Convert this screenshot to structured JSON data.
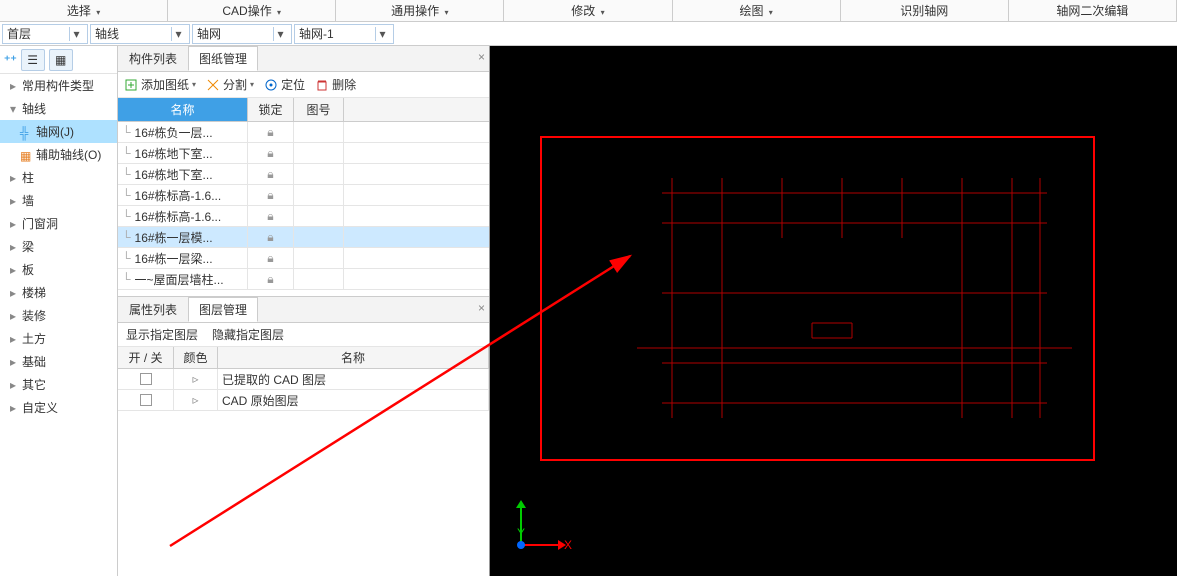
{
  "ribbon": [
    "选择",
    "CAD操作",
    "通用操作",
    "修改",
    "绘图",
    "识别轴网",
    "轴网二次编辑"
  ],
  "ribbon_caret": [
    true,
    true,
    true,
    true,
    true,
    false,
    false
  ],
  "selectors": [
    {
      "label": "首层",
      "w": 86
    },
    {
      "label": "轴线",
      "w": 100
    },
    {
      "label": "轴网",
      "w": 100
    },
    {
      "label": "轴网-1",
      "w": 100
    }
  ],
  "tree": [
    {
      "label": "常用构件类型",
      "glyph": "▸"
    },
    {
      "label": "轴线",
      "glyph": "▾"
    },
    {
      "label": "轴网(J)",
      "sub": true,
      "selected": true,
      "icon": "grid"
    },
    {
      "label": "辅助轴线(O)",
      "sub": true,
      "icon": "aux"
    },
    {
      "label": "柱",
      "glyph": "▸"
    },
    {
      "label": "墙",
      "glyph": "▸"
    },
    {
      "label": "门窗洞",
      "glyph": "▸"
    },
    {
      "label": "梁",
      "glyph": "▸"
    },
    {
      "label": "板",
      "glyph": "▸"
    },
    {
      "label": "楼梯",
      "glyph": "▸"
    },
    {
      "label": "装修",
      "glyph": "▸"
    },
    {
      "label": "土方",
      "glyph": "▸"
    },
    {
      "label": "基础",
      "glyph": "▸"
    },
    {
      "label": "其它",
      "glyph": "▸"
    },
    {
      "label": "自定义",
      "glyph": "▸"
    }
  ],
  "panel1": {
    "tabs": [
      "构件列表",
      "图纸管理"
    ],
    "active": 1,
    "toolbar": [
      "添加图纸",
      "分割",
      "定位",
      "删除"
    ],
    "headers": [
      "名称",
      "锁定",
      "图号"
    ],
    "rows": [
      {
        "name": "16#栋负一层..."
      },
      {
        "name": "16#栋地下室..."
      },
      {
        "name": "16#栋地下室..."
      },
      {
        "name": "16#栋标高-1.6..."
      },
      {
        "name": "16#栋标高-1.6..."
      },
      {
        "name": "16#栋一层模...",
        "selected": true
      },
      {
        "name": "16#栋一层梁..."
      },
      {
        "name": "一~屋面层墙柱..."
      }
    ]
  },
  "panel2": {
    "tabs": [
      "属性列表",
      "图层管理"
    ],
    "active": 1,
    "sub": [
      "显示指定图层",
      "隐藏指定图层"
    ],
    "headers": [
      "开 / 关",
      "颜色",
      "名称"
    ],
    "rows": [
      {
        "name": "已提取的 CAD 图层"
      },
      {
        "name": "CAD 原始图层"
      }
    ]
  },
  "axis": {
    "x": "X",
    "y": "Y"
  }
}
